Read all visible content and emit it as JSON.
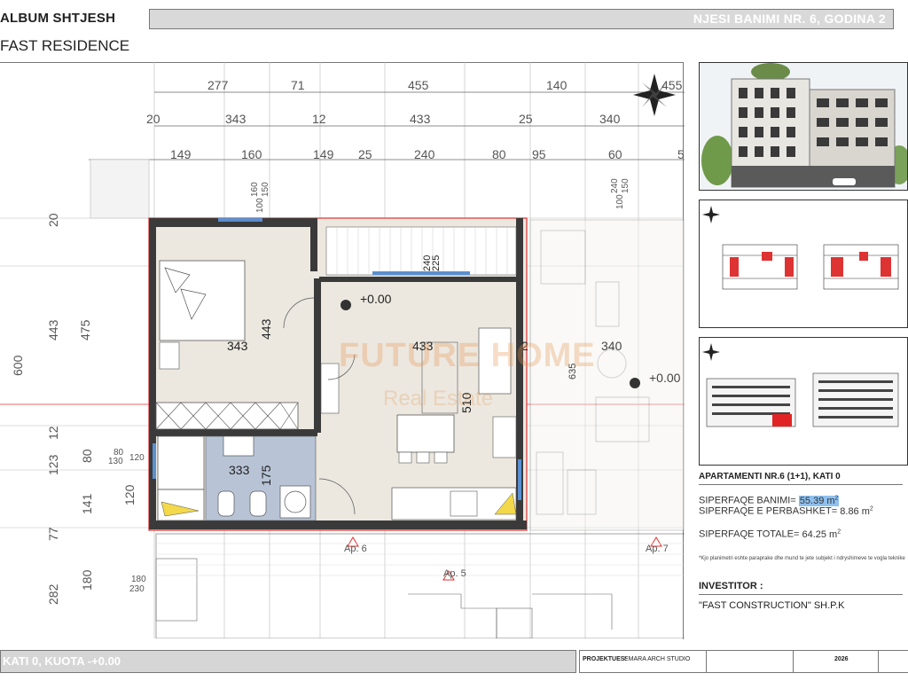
{
  "header": {
    "album_title": "ALBUM SHTJESH",
    "project_name": "FAST RESIDENCE",
    "unit_banner": "NJESI BANIMI NR. 6, GODINA 2"
  },
  "plan": {
    "dims_row1": [
      "277",
      "71",
      "455",
      "140",
      "455"
    ],
    "dims_row2": [
      "20",
      "343",
      "12",
      "433",
      "25",
      "340"
    ],
    "dims_row3": [
      "149",
      "160",
      "149",
      "25",
      "240",
      "80",
      "95",
      "60",
      "5"
    ],
    "dims_left": [
      "600",
      "443",
      "475",
      "20",
      "12",
      "123",
      "80",
      "141",
      "77",
      "120",
      "282",
      "180"
    ],
    "dims_small": [
      "160",
      "150",
      "100",
      "240",
      "150",
      "100",
      "80",
      "130",
      "120",
      "180",
      "230"
    ],
    "room_dims": [
      "343",
      "443",
      "433",
      "510",
      "333",
      "175",
      "340",
      "635",
      "2",
      "240",
      "225"
    ],
    "level_labels": [
      "+0.00",
      "+0.00"
    ],
    "apartment_labels": [
      "Ap. 6",
      "Ap. 5",
      "Ap. 7"
    ],
    "watermark_brand": "FUTURE HOME",
    "watermark_sub": "Real Estate"
  },
  "side": {
    "apartment_title": "APARTAMENTI NR.6 (1+1), KATI 0",
    "area_living_label": "SIPERFAQE BANIMI=",
    "area_living_value": "55.39 m",
    "area_shared_label": "SIPERFAQE E PERBASHKET=",
    "area_shared_value": "8.86 m",
    "area_total_label": "SIPERFAQE TOTALE=",
    "area_total_value": "64.25 m",
    "area_unit_exp": "2",
    "note": "*Kjo planimetri eshte paraprake dhe mund te jete subjekt i ndryshimeve te vogla teknike",
    "investor_label": "INVESTITOR :",
    "investor_name": "\"FAST CONSTRUCTION\" SH.P.K"
  },
  "footer": {
    "floor_label": "KATI 0, KUOTA -+0.00",
    "project_label": "PROJEKTUES:",
    "project_value": "EMARA ARCH STUDIO",
    "year": "2026"
  },
  "colors": {
    "wall": "#3a3a3a",
    "red_line": "#e03030",
    "hatch_gray": "#c8c8c8",
    "bath_blue": "#b8c4d6",
    "floor_beige": "#ece8e0",
    "banner_gray": "#d9d9d9"
  }
}
